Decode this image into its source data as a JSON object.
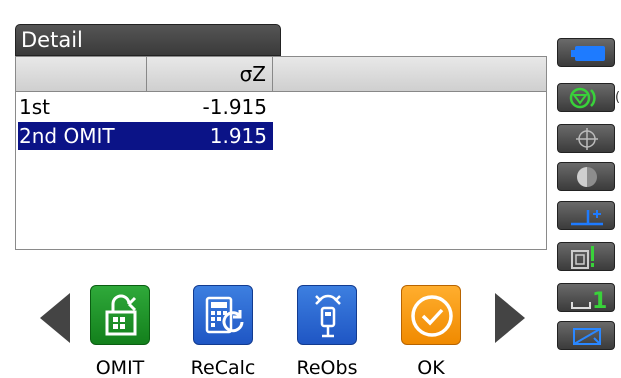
{
  "title": "Detail",
  "table": {
    "headers": [
      "",
      "σZ",
      ""
    ],
    "rows": [
      {
        "name": "1st",
        "value": "-1.915",
        "selected": false
      },
      {
        "name": "2nd OMIT",
        "value": "1.915",
        "selected": true
      }
    ]
  },
  "softkeys": {
    "omit": {
      "label": "OMIT",
      "icon": "omit-icon"
    },
    "recalc": {
      "label": "ReCalc",
      "icon": "recalc-icon"
    },
    "reobs": {
      "label": "ReObs",
      "icon": "reobs-icon"
    },
    "ok": {
      "label": "OK",
      "icon": "check-icon"
    }
  },
  "status_bar": {
    "items": [
      {
        "icon": "battery-icon"
      },
      {
        "icon": "target-prism-icon"
      },
      {
        "icon": "crosshair-icon"
      },
      {
        "icon": "half-circle-icon"
      },
      {
        "icon": "tilt-icon"
      },
      {
        "icon": "signal-icon"
      },
      {
        "icon": "input-mode-icon",
        "text": "1"
      },
      {
        "icon": "keyboard-icon"
      }
    ],
    "side_text": "("
  },
  "colors": {
    "selection": "#0b1387",
    "omit_key": "#1f9a2a",
    "blue_key": "#2a67d3",
    "ok_key": "#f59a10",
    "status_accent_blue": "#1e7bff",
    "status_accent_green": "#39d23a"
  }
}
